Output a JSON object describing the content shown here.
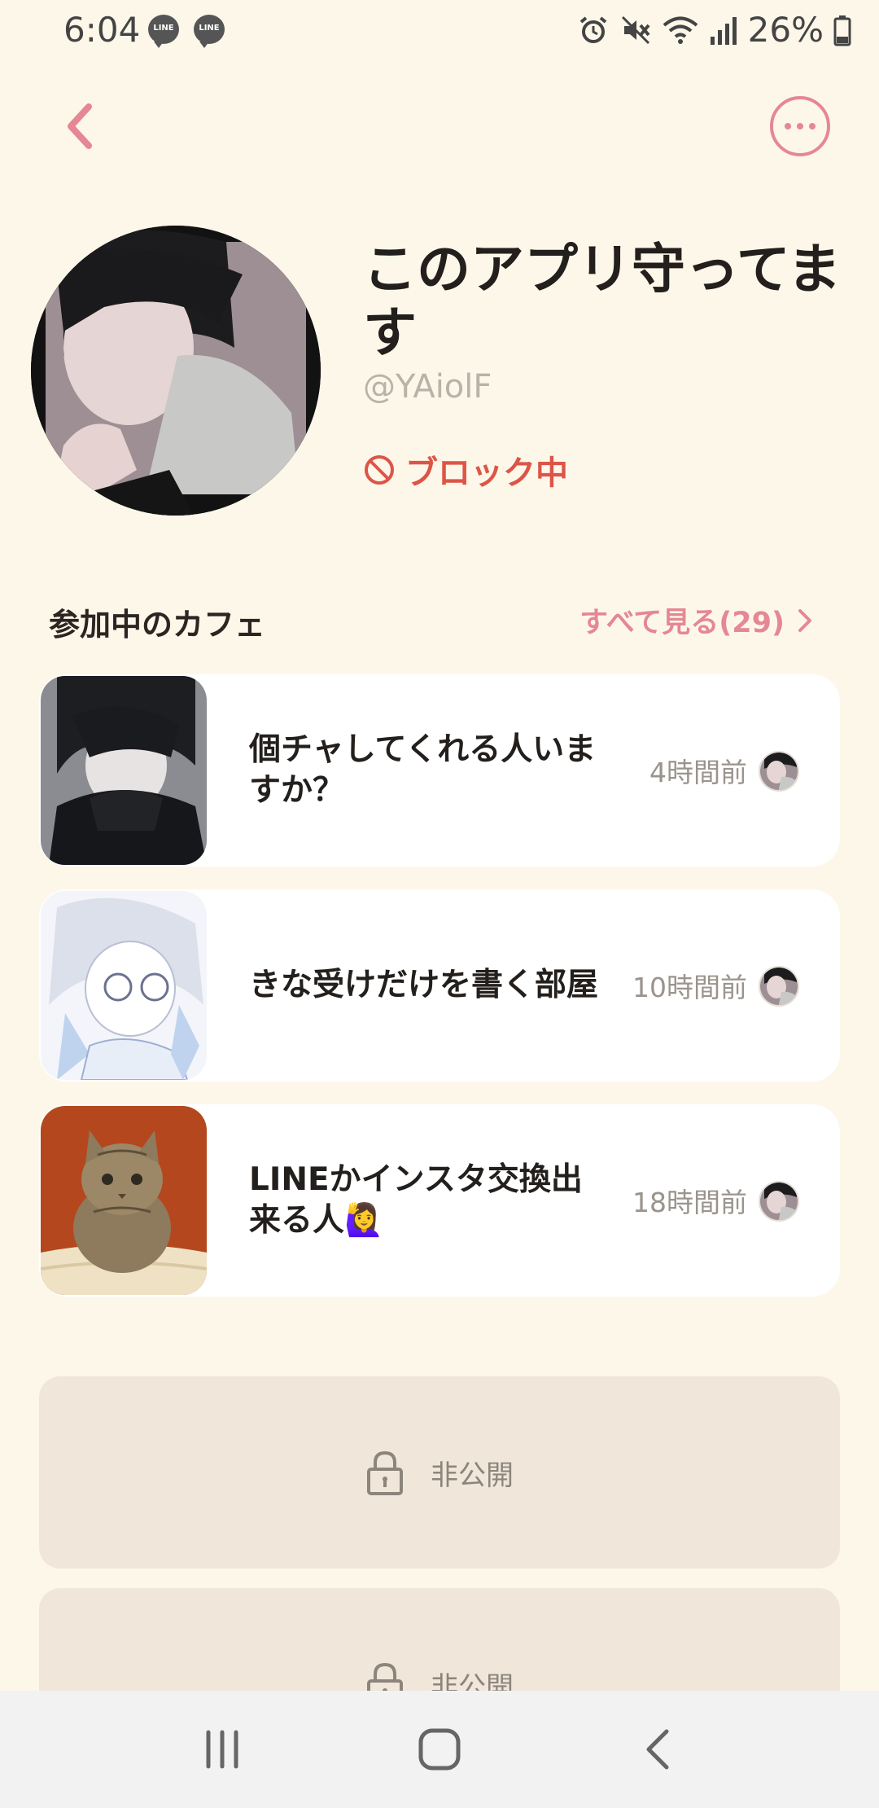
{
  "status_bar": {
    "time": "6:04",
    "notifications": [
      "LINE",
      "LINE"
    ],
    "battery": "26%",
    "icons": [
      "alarm-icon",
      "mute-icon",
      "wifi-icon",
      "signal-icon",
      "battery-icon"
    ]
  },
  "top_bar": {
    "back_icon": "chevron-left-icon",
    "more_icon": "more-horizontal-icon"
  },
  "profile": {
    "name": "このアプリ守ってます",
    "handle": "@YAiolF",
    "block_status": "ブロック中"
  },
  "cafes_section": {
    "title": "参加中のカフェ",
    "see_all": "すべて見る(29)",
    "items": [
      {
        "title": "個チャしてくれる人いますか？",
        "time": "4時間前"
      },
      {
        "title": "きな受けだけを書く部屋",
        "time": "10時間前"
      },
      {
        "title": "LINEかインスタ交換出来る人🙋‍♀️",
        "time": "18時間前"
      }
    ]
  },
  "private_items": [
    {
      "label": "非公開"
    },
    {
      "label": "非公開"
    }
  ],
  "nav_bar": {
    "buttons": [
      "recent-apps-icon",
      "home-icon",
      "back-icon"
    ]
  },
  "colors": {
    "background": "#FDF7EA",
    "accent": "#E58795",
    "block_red": "#DC5547",
    "private_bg": "#F0E6DA"
  }
}
